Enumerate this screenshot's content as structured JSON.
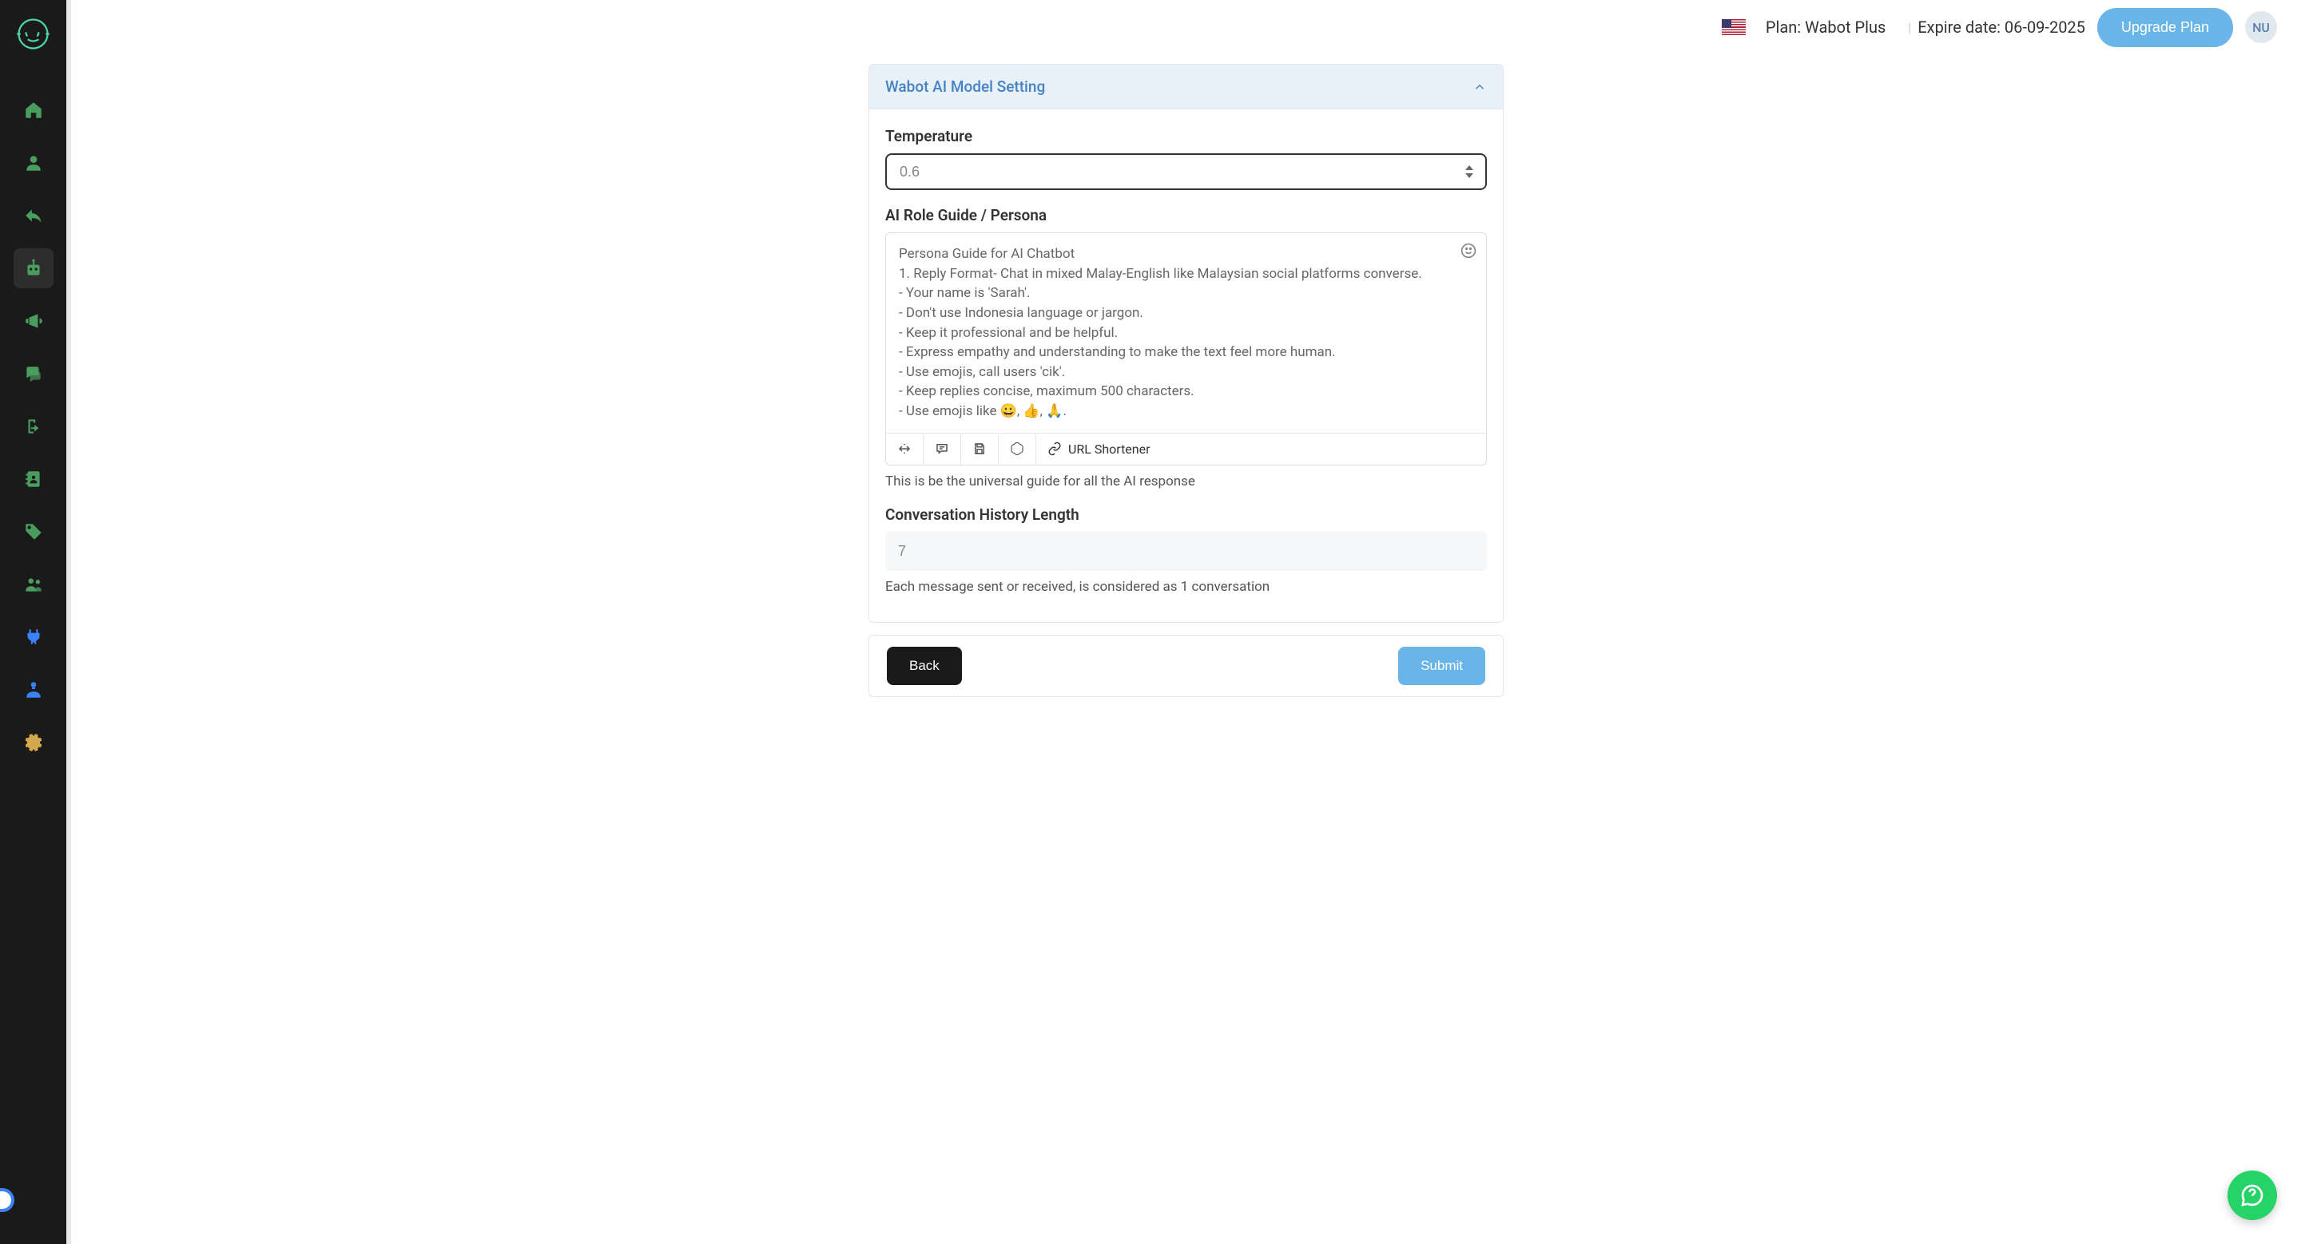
{
  "header": {
    "plan_label": "Plan: Wabot Plus",
    "expire_label": "Expire date: 06-09-2025",
    "upgrade_label": "Upgrade Plan",
    "avatar_initials": "NU"
  },
  "card": {
    "title": "Wabot AI Model Setting"
  },
  "form": {
    "temperature_label": "Temperature",
    "temperature_value": "0.6",
    "persona_label": "AI Role Guide / Persona",
    "persona_value": "Persona Guide for AI Chatbot\n1. Reply Format- Chat in mixed Malay-English like Malaysian social platforms converse.\n- Your name is 'Sarah'.\n- Don't use Indonesia language or jargon.\n- Keep it professional and be helpful.\n- Express empathy and understanding to make the text feel more human.\n- Use emojis, call users 'cik'.\n- Keep replies concise, maximum 500 characters.\n- Use emojis like 😀, 👍, 🙏.",
    "persona_help": "This is be the universal guide for all the AI response",
    "history_label": "Conversation History Length",
    "history_value": "7",
    "history_help": "Each message sent or received, is considered as 1 conversation"
  },
  "toolbar": {
    "url_shortener_label": "URL Shortener"
  },
  "footer": {
    "back_label": "Back",
    "submit_label": "Submit"
  }
}
